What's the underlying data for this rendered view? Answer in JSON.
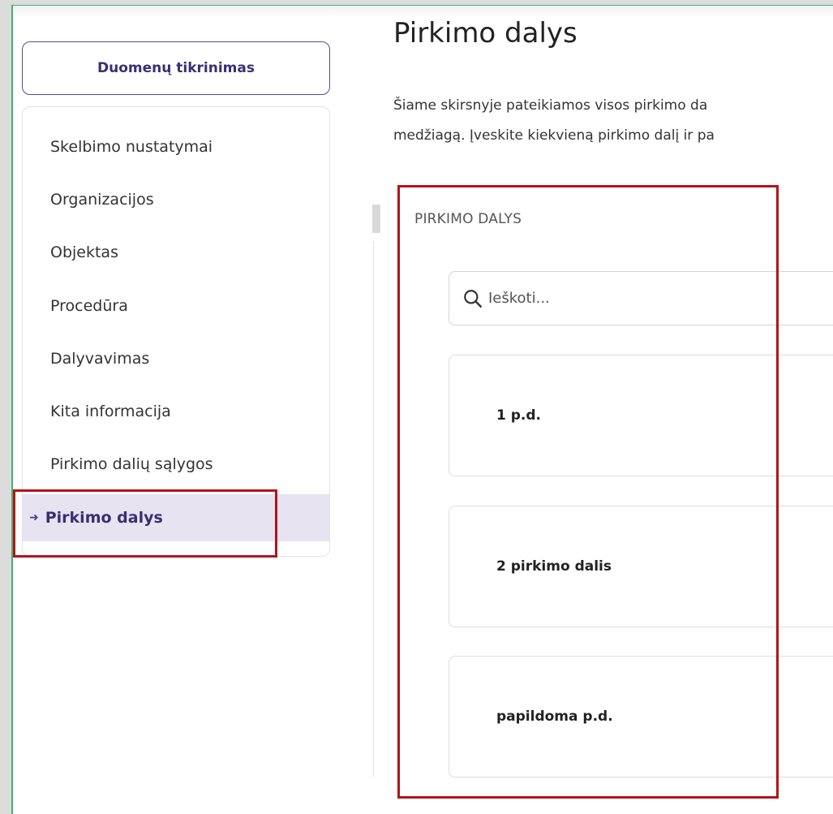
{
  "sidebar": {
    "check_button": "Duomenų tikrinimas",
    "items": [
      {
        "label": "Skelbimo nustatymai",
        "active": false
      },
      {
        "label": "Organizacijos",
        "active": false
      },
      {
        "label": "Objektas",
        "active": false
      },
      {
        "label": "Procedūra",
        "active": false
      },
      {
        "label": "Dalyvavimas",
        "active": false
      },
      {
        "label": "Kita informacija",
        "active": false
      },
      {
        "label": "Pirkimo dalių sąlygos",
        "active": false
      },
      {
        "label": "Pirkimo dalys",
        "active": true
      }
    ],
    "active_icon": "chevron-right-icon"
  },
  "main": {
    "title": "Pirkimo dalys",
    "description_lines": [
      "Šiame skirsnyje pateikiamos visos pirkimo da",
      "medžiagą. Įveskite kiekvieną pirkimo dalį ir pa"
    ],
    "section_label": "PIRKIMO DALYS",
    "search": {
      "placeholder": "Ieškoti...",
      "value": "",
      "icon": "search-icon"
    },
    "lots": [
      {
        "label": "1 p.d."
      },
      {
        "label": "2 pirkimo dalis"
      },
      {
        "label": "papildoma p.d."
      }
    ]
  },
  "colors": {
    "accent": "#3a2f73",
    "active_bg": "#e7e3f1",
    "highlight_border": "#b3141b",
    "frame_border": "#3cb371"
  }
}
